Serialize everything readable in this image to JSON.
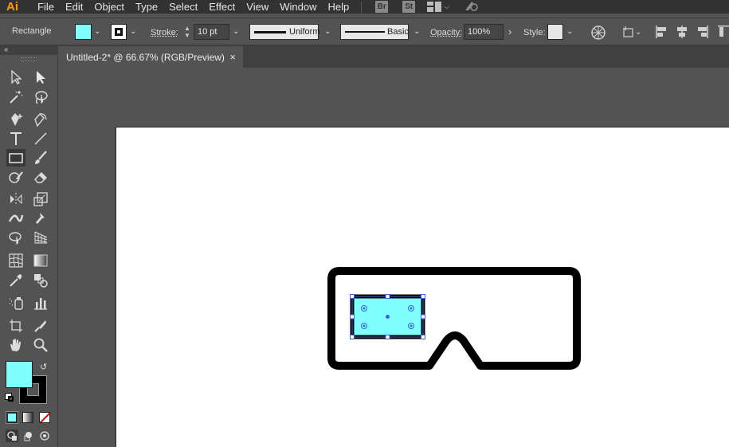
{
  "app": {
    "logo": "Ai"
  },
  "menu": {
    "items": [
      "File",
      "Edit",
      "Object",
      "Type",
      "Select",
      "Effect",
      "View",
      "Window",
      "Help"
    ],
    "bridge_label": "Br",
    "stock_label": "St"
  },
  "control_bar": {
    "tool_name": "Rectangle",
    "stroke_label": "Stroke:",
    "stroke_value": "10 pt",
    "profile_label": "Uniform",
    "brush_label": "Basic",
    "opacity_label": "Opacity:",
    "opacity_value": "100%",
    "style_label": "Style:"
  },
  "document": {
    "tab_title": "Untitled-2* @ 66.67% (RGB/Preview)",
    "close_glyph": "×"
  },
  "colors": {
    "fill": "#80ffff",
    "stroke": "#000000",
    "selection": "#3b64d8",
    "app_accent": "#ff9a00"
  },
  "tools": [
    "selection-tool",
    "direct-selection-tool",
    "magic-wand-tool",
    "lasso-tool",
    "pen-tool",
    "curvature-tool",
    "type-tool",
    "line-segment-tool",
    "rectangle-tool",
    "paintbrush-tool",
    "shaper-tool",
    "eraser-tool",
    "rotate-tool",
    "scale-tool",
    "width-tool",
    "puppet-warp-tool",
    "shape-builder-tool",
    "perspective-grid-tool",
    "mesh-tool",
    "gradient-tool",
    "eyedropper-tool",
    "blend-tool",
    "symbol-sprayer-tool",
    "column-graph-tool",
    "artboard-tool",
    "slice-tool",
    "hand-tool",
    "zoom-tool"
  ]
}
